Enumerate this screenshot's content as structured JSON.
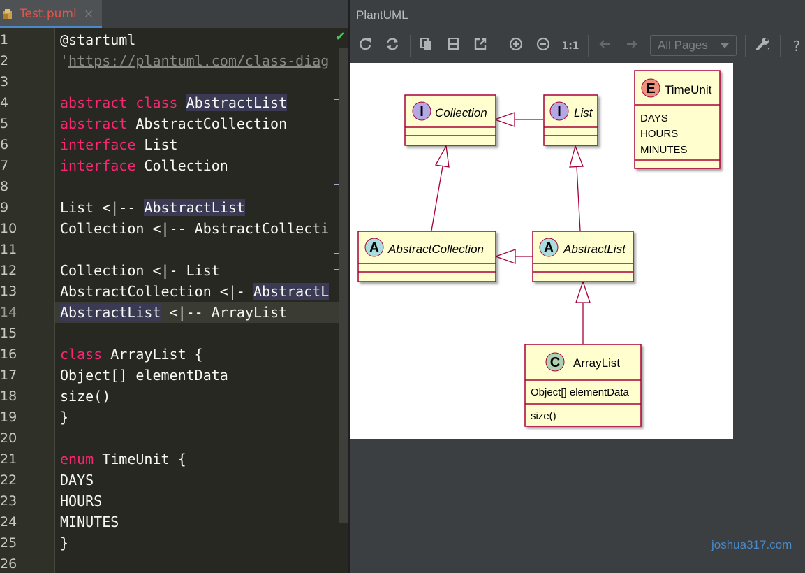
{
  "editor": {
    "tab": {
      "label": "Test.puml",
      "close": "×"
    },
    "check": "✔",
    "line_numbers": [
      "1",
      "2",
      "3",
      "4",
      "5",
      "6",
      "7",
      "8",
      "9",
      "10",
      "11",
      "12",
      "13",
      "14",
      "15",
      "16",
      "17",
      "18",
      "19",
      "20",
      "21",
      "22",
      "23",
      "24",
      "25",
      "26"
    ],
    "lines": {
      "l1": "@startuml",
      "l2_quote": "'",
      "l2_url": "https://plantuml.com/class-diag",
      "l4_kw1": "abstract",
      "l4_kw2": "class",
      "l4_name": "AbstractList",
      "l5_kw": "abstract",
      "l5_name": "AbstractCollection",
      "l6_kw": "interface",
      "l6_name": "List",
      "l7_kw": "interface",
      "l7_name": "Collection",
      "l9_a": "List <|-- ",
      "l9_b": "AbstractList",
      "l10": "Collection <|-- AbstractCollecti",
      "l12": "Collection <|- List",
      "l13_a": "AbstractCollection <|- ",
      "l13_b": "AbstractL",
      "l14_a": "AbstractList",
      "l14_b": " <|-- ArrayList",
      "l16_kw": "class",
      "l16_rest": " ArrayList {",
      "l17": "Object[] elementData",
      "l18": "size()",
      "l19": "}",
      "l21_kw": "enum",
      "l21_rest": " TimeUnit {",
      "l22": "DAYS",
      "l23": "HOURS",
      "l24": "MINUTES",
      "l25": "}"
    }
  },
  "panel": {
    "title": "PlantUML",
    "toolbar": {
      "zoom_reset": "1:1",
      "pages_select": "All Pages",
      "help": "?"
    }
  },
  "diagram": {
    "classes": {
      "collection": {
        "stereotype": "I",
        "name": "Collection"
      },
      "list": {
        "stereotype": "I",
        "name": "List"
      },
      "abstract_collection": {
        "stereotype": "A",
        "name": "AbstractCollection"
      },
      "abstract_list": {
        "stereotype": "A",
        "name": "AbstractList"
      },
      "array_list": {
        "stereotype": "C",
        "name": "ArrayList",
        "field": "Object[] elementData",
        "method": "size()"
      },
      "time_unit": {
        "stereotype": "E",
        "name": "TimeUnit",
        "values": [
          "DAYS",
          "HOURS",
          "MINUTES"
        ]
      }
    },
    "colors": {
      "class_fill": "#fefece",
      "border": "#a80036",
      "interface_circle": "#b4a7e5",
      "abstract_circle": "#a9dcdf",
      "class_circle": "#add1b2",
      "enum_circle": "#eb937f"
    }
  },
  "watermark": "joshua317.com"
}
